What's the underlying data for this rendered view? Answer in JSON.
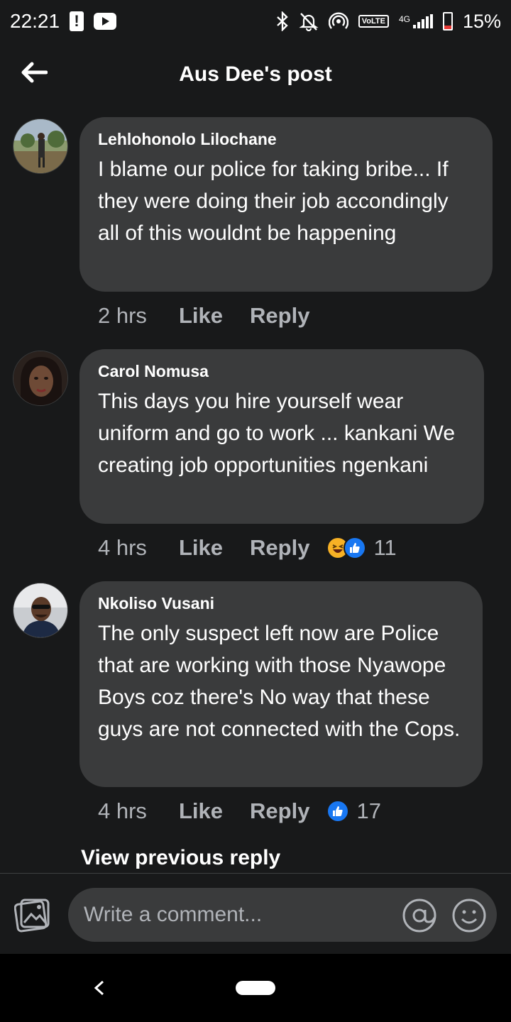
{
  "status_bar": {
    "time": "22:21",
    "network": "4G",
    "volte": "VoLTE",
    "battery": "15%",
    "icons": [
      "alert-icon",
      "youtube-icon",
      "bluetooth-icon",
      "mute-icon",
      "hotspot-icon",
      "signal-icon",
      "battery-icon"
    ]
  },
  "header": {
    "title": "Aus Dee's post",
    "back_icon": "back-arrow-icon"
  },
  "comments": [
    {
      "author": "Lehlohonolo Lilochane",
      "text": "I blame our police for taking bribe... If they were doing their job accondingly all of this wouldnt be happening",
      "time": "2 hrs",
      "like_label": "Like",
      "reply_label": "Reply",
      "reactions": [],
      "reaction_count": ""
    },
    {
      "author": "Carol Nomusa",
      "text": "This days you hire yourself wear uniform and go to work ... kankani We creating job opportunities ngenkani",
      "time": "4 hrs",
      "like_label": "Like",
      "reply_label": "Reply",
      "reactions": [
        "haha",
        "like"
      ],
      "reaction_count": "11"
    },
    {
      "author": "Nkoliso Vusani",
      "text": "The only suspect left now are Police that are working with those Nyawope Boys coz there's No way that these guys are not connected with the Cops.",
      "time": "4 hrs",
      "like_label": "Like",
      "reply_label": "Reply",
      "reactions": [
        "like"
      ],
      "reaction_count": "17"
    }
  ],
  "view_previous": "View previous reply",
  "composer": {
    "placeholder": "Write a comment...",
    "icons": [
      "photo-icon",
      "mention-icon",
      "emoji-icon"
    ]
  },
  "colors": {
    "background": "#18191a",
    "bubble": "#3a3b3c",
    "secondary_text": "#b0b3b8",
    "like_blue": "#1877f2",
    "haha_yellow": "#f7b125"
  }
}
